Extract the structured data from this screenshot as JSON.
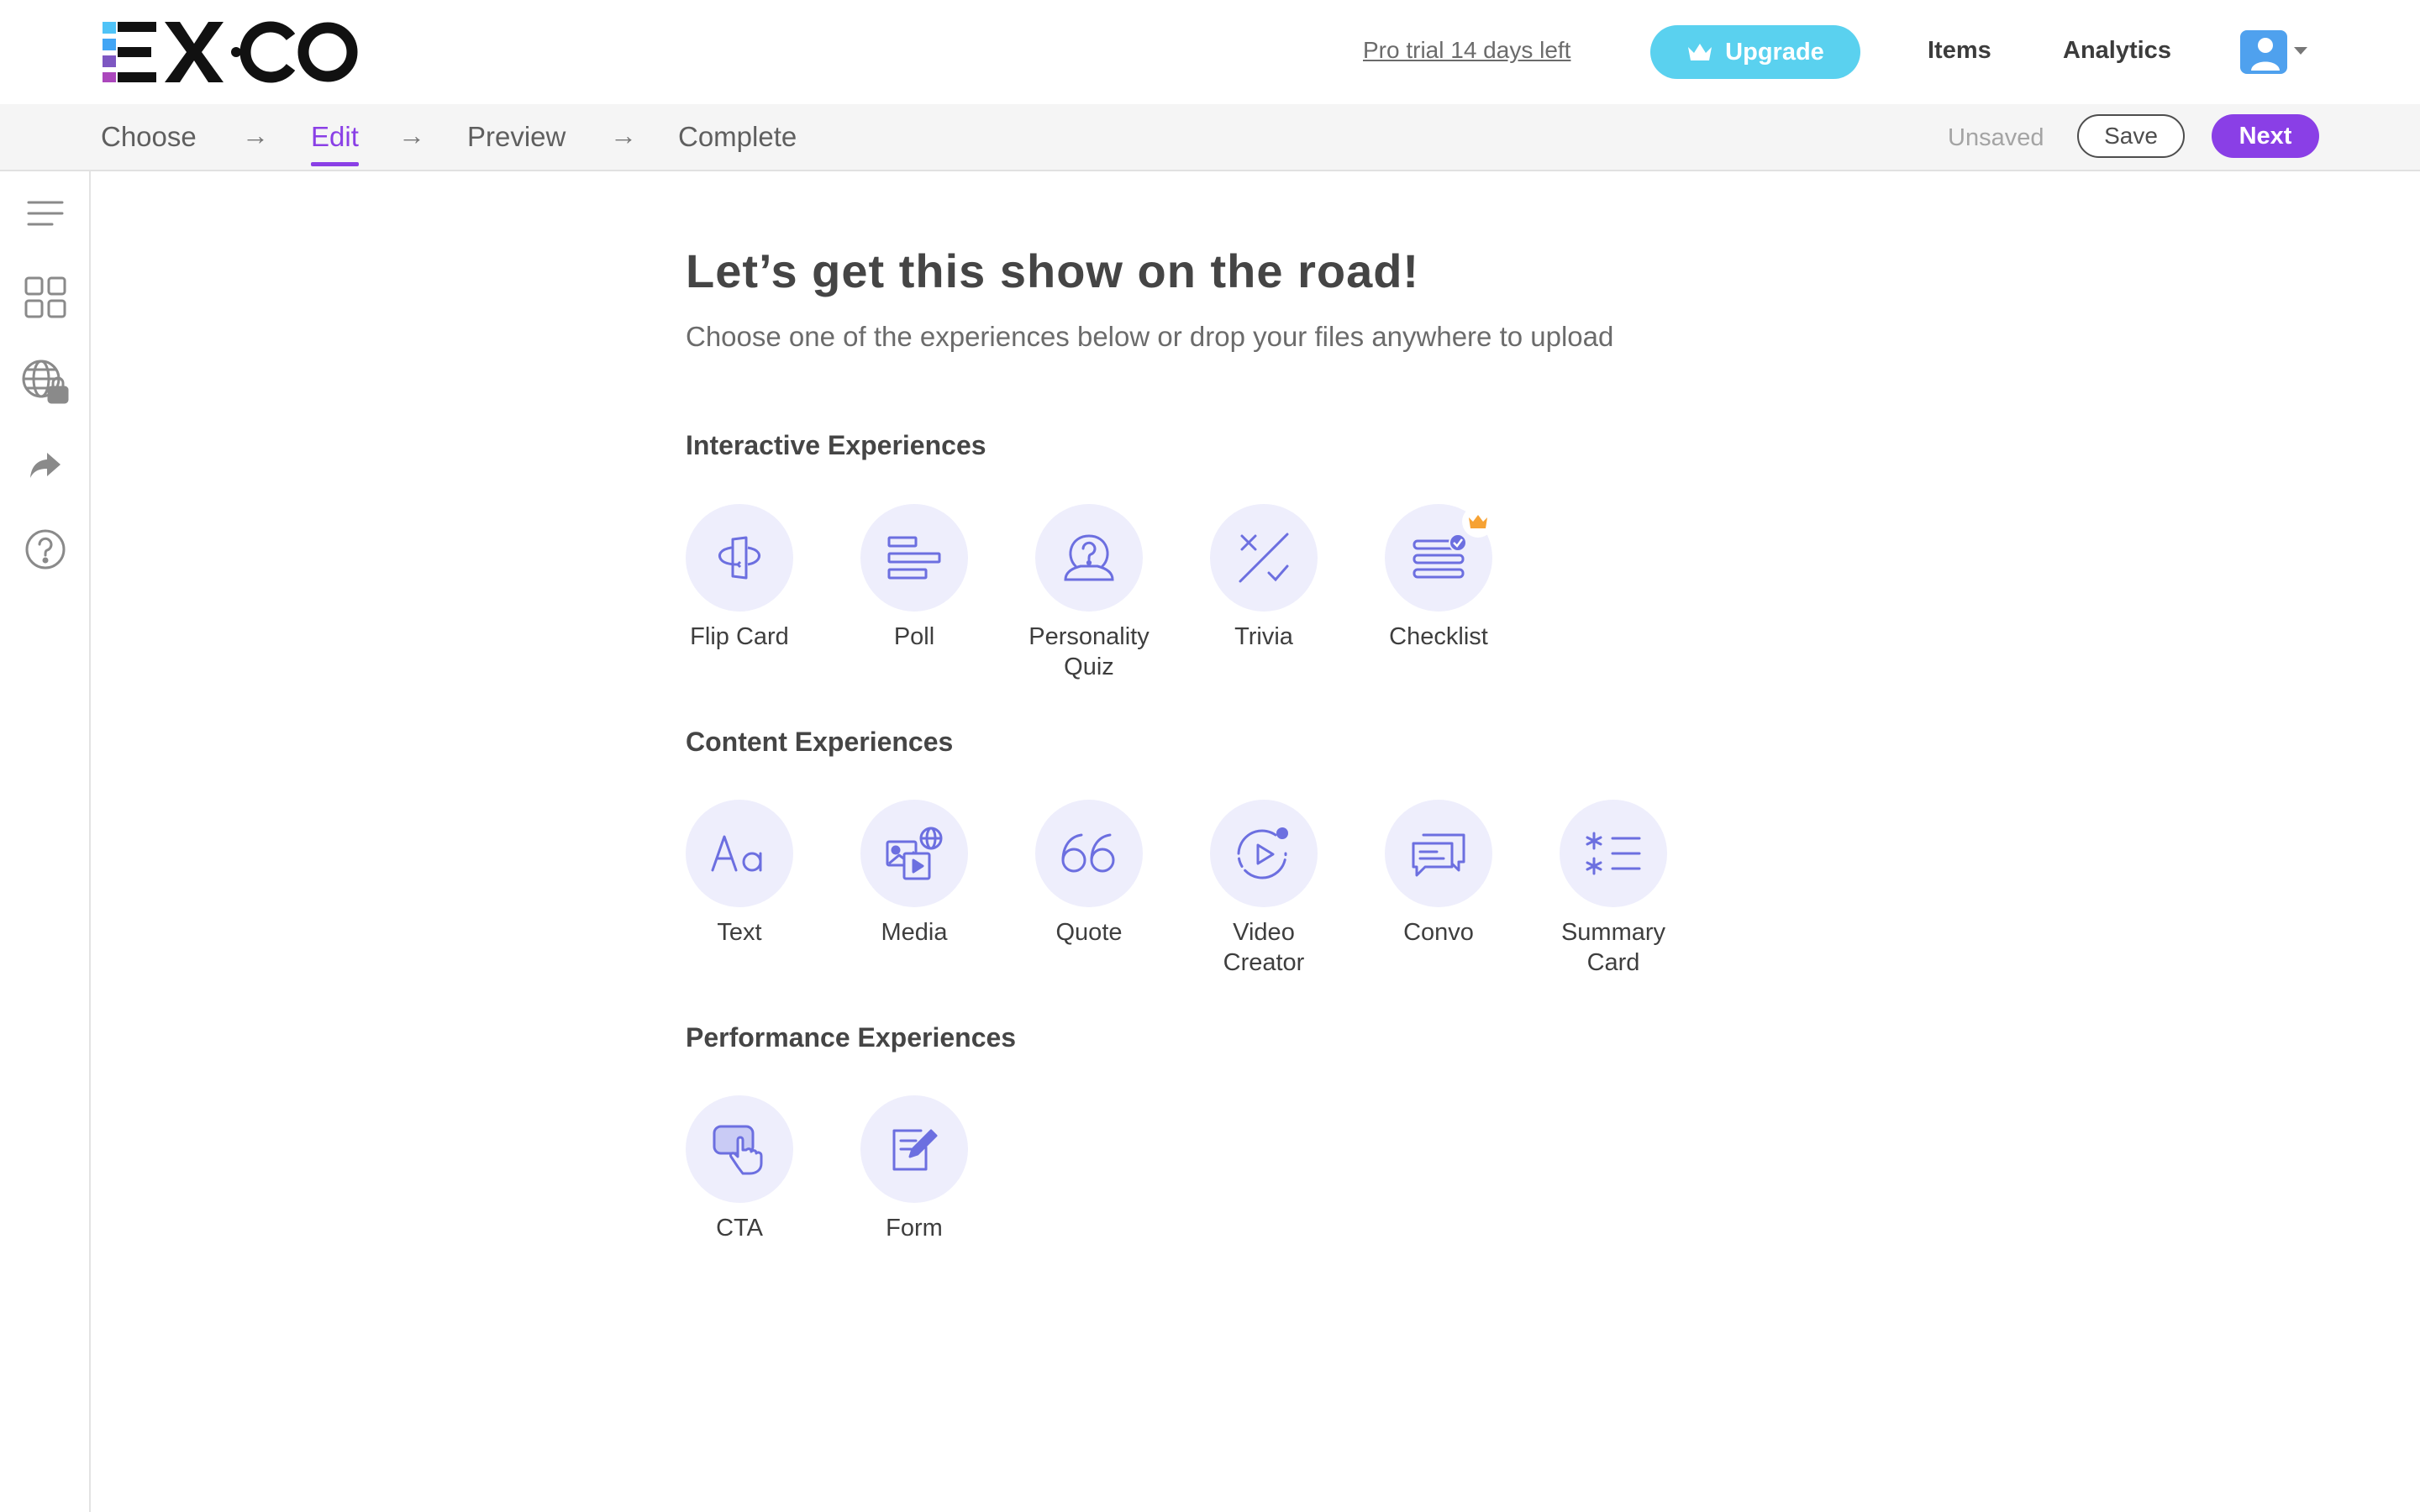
{
  "header": {
    "logo_text": "EX·CO",
    "trial_text": "Pro trial 14 days left",
    "upgrade_label": "Upgrade",
    "nav": {
      "items": "Items",
      "analytics": "Analytics"
    }
  },
  "stepper": {
    "steps": [
      "Choose",
      "Edit",
      "Preview",
      "Complete"
    ],
    "arrow": "→",
    "active_step": "Edit",
    "status": "Unsaved",
    "save_label": "Save",
    "next_label": "Next"
  },
  "sidebar": {
    "icons": [
      "menu-icon",
      "grid-icon",
      "globe-lock-icon",
      "share-icon",
      "help-icon"
    ]
  },
  "main": {
    "title": "Let’s get this show on the road!",
    "subtitle": "Choose one of the experiences below or drop your files anywhere to upload",
    "sections": [
      {
        "title": "Interactive Experiences",
        "items": [
          {
            "label": "Flip Card",
            "icon": "flip-card-icon"
          },
          {
            "label": "Poll",
            "icon": "poll-icon"
          },
          {
            "label": "Personality Quiz",
            "icon": "personality-quiz-icon"
          },
          {
            "label": "Trivia",
            "icon": "trivia-icon"
          },
          {
            "label": "Checklist",
            "icon": "checklist-icon",
            "premium": true
          }
        ]
      },
      {
        "title": "Content Experiences",
        "items": [
          {
            "label": "Text",
            "icon": "text-icon"
          },
          {
            "label": "Media",
            "icon": "media-icon"
          },
          {
            "label": "Quote",
            "icon": "quote-icon"
          },
          {
            "label": "Video Creator",
            "icon": "video-creator-icon"
          },
          {
            "label": "Convo",
            "icon": "convo-icon"
          },
          {
            "label": "Summary Card",
            "icon": "summary-card-icon"
          }
        ]
      },
      {
        "title": "Performance Experiences",
        "items": [
          {
            "label": "CTA",
            "icon": "cta-icon"
          },
          {
            "label": "Form",
            "icon": "form-icon"
          }
        ]
      }
    ]
  },
  "colors": {
    "accent": "#8a3fe6",
    "upgrade": "#5ad1ef",
    "icon_stroke": "#6c6fe0",
    "tile_bg": "#eeeefc"
  }
}
